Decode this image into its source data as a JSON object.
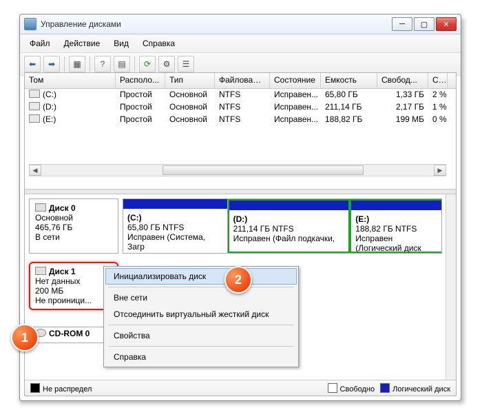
{
  "window": {
    "title": "Управление дисками"
  },
  "menu": {
    "file": "Файл",
    "action": "Действие",
    "view": "Вид",
    "help": "Справка"
  },
  "columns": {
    "vol": "Том",
    "layout": "Располо...",
    "type": "Тип",
    "fs": "Файловая с...",
    "status": "Состояние",
    "cap": "Емкость",
    "free": "Свобод...",
    "pct": "Св"
  },
  "rows": [
    {
      "name": "(C:)",
      "layout": "Простой",
      "type": "Основной",
      "fs": "NTFS",
      "status": "Исправен...",
      "cap": "65,80 ГБ",
      "free": "1,33 ГБ",
      "pct": "2 %"
    },
    {
      "name": "(D:)",
      "layout": "Простой",
      "type": "Основной",
      "fs": "NTFS",
      "status": "Исправен...",
      "cap": "211,14 ГБ",
      "free": "2,17 ГБ",
      "pct": "1 %"
    },
    {
      "name": "(E:)",
      "layout": "Простой",
      "type": "Основной",
      "fs": "NTFS",
      "status": "Исправен...",
      "cap": "188,82 ГБ",
      "free": "199 МБ",
      "pct": "0 %"
    }
  ],
  "disk0": {
    "title": "Диск 0",
    "kind": "Основной",
    "size": "465,76 ГБ",
    "state": "В сети",
    "parts": [
      {
        "name": "(C:)",
        "info": "65,80 ГБ NTFS",
        "status": "Исправен (Система, Загр"
      },
      {
        "name": "(D:)",
        "info": "211,14 ГБ NTFS",
        "status": "Исправен (Файл подкачки,"
      },
      {
        "name": "(E:)",
        "info": "188,82 ГБ NTFS",
        "status": "Исправен (Логический диск"
      }
    ]
  },
  "disk1": {
    "title": "Диск 1",
    "line1": "Нет данных",
    "line2": "200 МБ",
    "line3": "Не проиници..."
  },
  "cdrom": {
    "title": "CD-ROM 0"
  },
  "legend": {
    "unalloc": "Не распредел",
    "free": "Свободно",
    "logical": "Логический диск"
  },
  "context": {
    "init": "Инициализировать диск",
    "offline": "Вне сети",
    "detach": "Отсоединить виртуальный жесткий диск",
    "props": "Свойства",
    "help": "Справка"
  },
  "badges": {
    "one": "1",
    "two": "2"
  }
}
